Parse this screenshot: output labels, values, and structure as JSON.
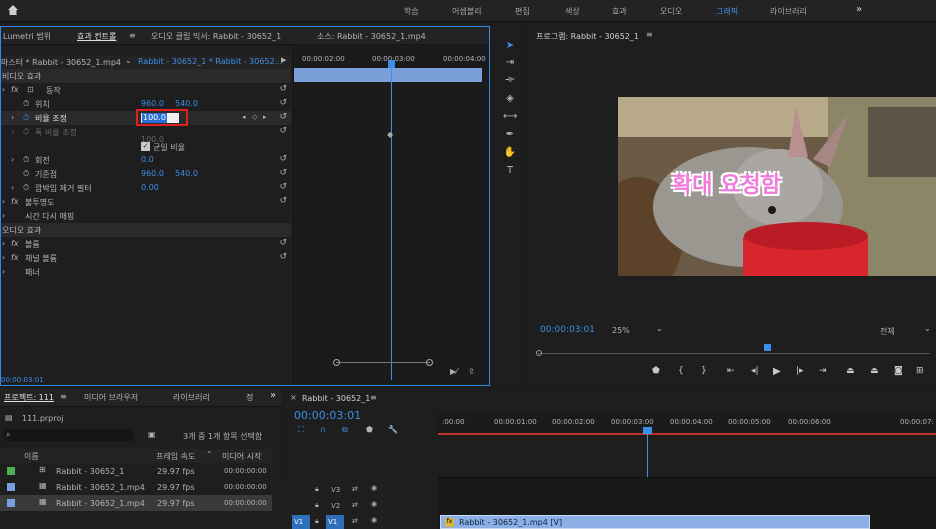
{
  "topbar": {
    "tabs": [
      "학습",
      "어셈블리",
      "편집",
      "색상",
      "효과",
      "오디오",
      "그래픽",
      "라이브러리"
    ],
    "active_tab": "그래픽",
    "more": "»"
  },
  "effects_panel": {
    "tabs": [
      "Lumetri 범위",
      "효과 컨트롤",
      "오디오 클립 믹서: Rabbit - 30652_1",
      "소스: Rabbit - 30652_1.mp4"
    ],
    "menu_icon": "≡",
    "source_select": "마스터 * Rabbit - 30652_1.mp4",
    "sequence_link": "Rabbit - 30652_1 * Rabbit - 30652...",
    "ruler": [
      "00:00:02:00",
      "00:00:03:00",
      "00:00:04:00"
    ],
    "video_effects": "비디오 효과",
    "motion": "동작",
    "position": {
      "label": "위치",
      "x": "960.0",
      "y": "540.0"
    },
    "scale": {
      "label": "비율 조정",
      "value": "100.0"
    },
    "scale_width": {
      "label": "폭 비율 조정",
      "value": "100.0"
    },
    "uniform": "균일 비율",
    "rotation": {
      "label": "회전",
      "value": "0.0"
    },
    "anchor": {
      "label": "기준점",
      "x": "960.0",
      "y": "540.0"
    },
    "flicker": {
      "label": "깜박임 제거 필터",
      "value": "0.00"
    },
    "opacity": "불투명도",
    "time_remap": "시간 다시 매핑",
    "audio_effects": "오디오 효과",
    "volume": "볼륨",
    "channel_volume": "채널 볼륨",
    "panner": "패너",
    "timecode": "00:00:03:01"
  },
  "program": {
    "title": "프로그램: Rabbit - 30652_1",
    "caption": "확대 요청함",
    "timecode": "00:00:03:01",
    "zoom": "25%",
    "quality": "전체"
  },
  "project": {
    "tabs": [
      "프로젝트: 111",
      "미디어 브라우저",
      "라이브러리",
      "정"
    ],
    "file": "111.prproj",
    "selection_info": "3개 중 1개 항목 선택함",
    "columns": [
      "이름",
      "프레임 속도",
      "미디어 시작"
    ],
    "items": [
      {
        "name": "Rabbit - 30652_1",
        "fps": "29.97 fps",
        "start": "00:00:00:00",
        "color": "#4caf50"
      },
      {
        "name": "Rabbit - 30652_1.mp4",
        "fps": "29.97 fps",
        "start": "00:00:00:00",
        "color": "#7b9fd8"
      },
      {
        "name": "Rabbit - 30652_1.mp4",
        "fps": "29.97 fps",
        "start": "00:00:00:00",
        "color": "#7b9fd8"
      }
    ]
  },
  "timeline": {
    "title": "Rabbit - 30652_1",
    "timecode": "00:00:03:01",
    "ruler": [
      ":00:00",
      "00:00:01:00",
      "00:00:02:00",
      "00:00:03:00",
      "00:00:04:00",
      "00:00:05:00",
      "00:00:06:00",
      "00:00:07:"
    ],
    "tracks": [
      "V3",
      "V2",
      "V1"
    ],
    "source_patch": "V1",
    "clip": "Rabbit - 30652_1.mp4 [V]"
  }
}
